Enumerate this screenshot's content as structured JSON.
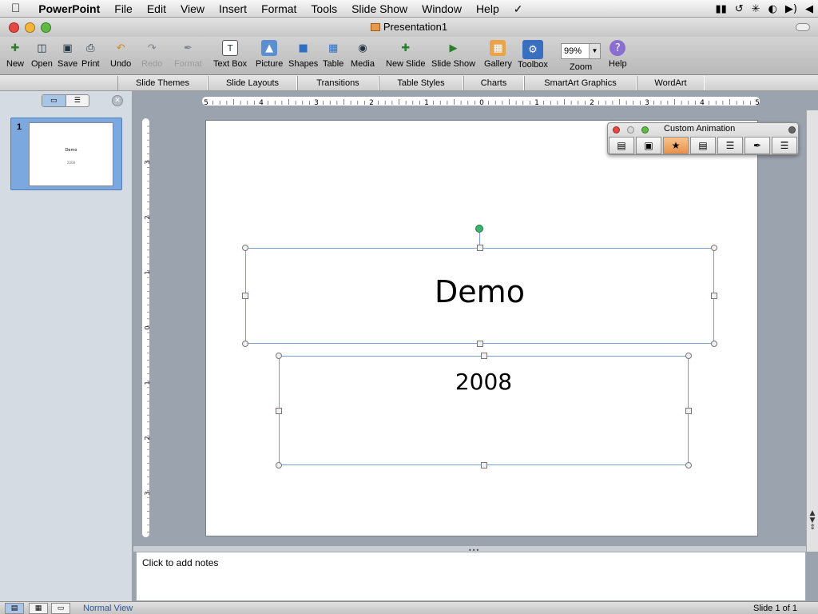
{
  "menubar": {
    "apple": "",
    "app_name": "PowerPoint",
    "items": [
      "File",
      "Edit",
      "View",
      "Insert",
      "Format",
      "Tools",
      "Slide Show",
      "Window",
      "Help"
    ],
    "script_icon": "script-icon",
    "status_icons": [
      "battery-icon",
      "time-machine-icon",
      "bluetooth-icon",
      "wifi-icon",
      "volume-icon"
    ]
  },
  "window": {
    "title": "Presentation1",
    "traffic": {
      "close": "#e8473f",
      "minimize": "#f4b53a",
      "zoom": "#5dbb43"
    }
  },
  "toolbar": {
    "new": "New",
    "open": "Open",
    "save": "Save",
    "print": "Print",
    "undo": "Undo",
    "redo": "Redo",
    "format": "Format",
    "text_box": "Text Box",
    "picture": "Picture",
    "shapes": "Shapes",
    "table": "Table",
    "media": "Media",
    "new_slide": "New Slide",
    "slide_show": "Slide Show",
    "gallery": "Gallery",
    "toolbox": "Toolbox",
    "zoom_value": "99%",
    "zoom": "Zoom",
    "help": "Help"
  },
  "ribbon": {
    "tabs": [
      "Slide Themes",
      "Slide Layouts",
      "Transitions",
      "Table Styles",
      "Charts",
      "SmartArt Graphics",
      "WordArt"
    ]
  },
  "slide_pane": {
    "thumb_number": "1",
    "thumb_title": "Demo",
    "thumb_subtitle": "2008",
    "selection_color": "#7ba8de"
  },
  "ruler": {
    "h_labels": [
      "5",
      "4",
      "3",
      "2",
      "1",
      "0",
      "1",
      "2",
      "3",
      "4",
      "5"
    ],
    "v_labels": [
      "3",
      "2",
      "1",
      "0",
      "1",
      "2",
      "3"
    ]
  },
  "slide": {
    "title": "Demo",
    "subtitle": "2008"
  },
  "custom_animation": {
    "title": "Custom Animation",
    "buttons": [
      "text-icon",
      "add-picture-icon",
      "animate-star-icon",
      "media-icon",
      "library-icon",
      "tools-icon",
      "stack-icon"
    ],
    "selected_index": 2
  },
  "notes": {
    "placeholder": "Click to add notes"
  },
  "statusbar": {
    "view_name": "Normal View",
    "slide_count": "Slide 1 of 1"
  }
}
